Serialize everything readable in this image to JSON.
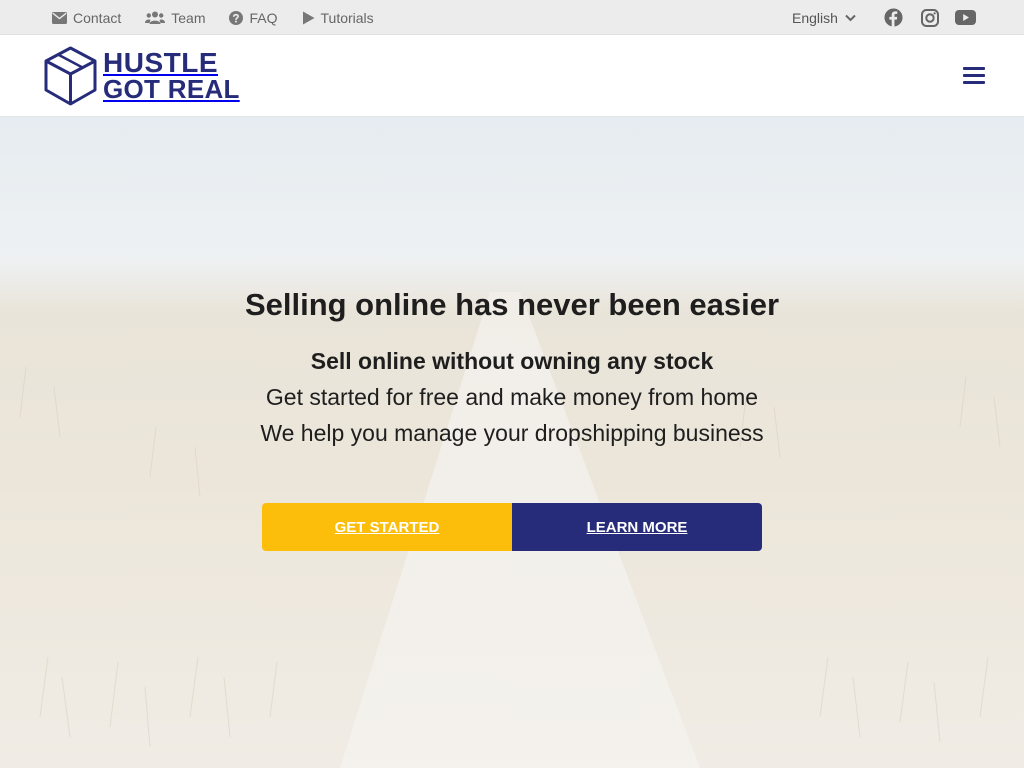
{
  "topbar": {
    "links": [
      {
        "label": "Contact",
        "icon": "envelope-icon"
      },
      {
        "label": "Team",
        "icon": "users-icon"
      },
      {
        "label": "FAQ",
        "icon": "question-circle-icon"
      },
      {
        "label": "Tutorials",
        "icon": "play-icon"
      }
    ],
    "language": "English",
    "social": [
      "facebook-icon",
      "instagram-icon",
      "youtube-icon"
    ]
  },
  "header": {
    "logo": {
      "line1": "HUSTLE",
      "line2": "GOT REAL",
      "icon": "box-icon"
    },
    "menu_icon": "hamburger-menu-icon"
  },
  "hero": {
    "title": "Selling online has never been easier",
    "subtitle": "Sell online without owning any stock",
    "line1": "Get started for free and make money from home",
    "line2": "We help you manage your dropshipping business",
    "primary_button": "GET STARTED",
    "secondary_button": "LEARN MORE"
  },
  "colors": {
    "brand_navy": "#262b7a",
    "accent_yellow": "#fcbe0a",
    "topbar_bg": "#ececec"
  }
}
